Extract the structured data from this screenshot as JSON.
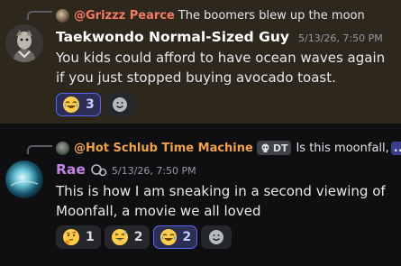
{
  "message1": {
    "reply": {
      "mention": "@Grizzz Pearce",
      "text": "The boomers blew up the moon"
    },
    "author": "Taekwondo Normal-Sized Guy",
    "timestamp": "5/13/26, 7:50 PM",
    "body": "You kids could afford to have ocean waves again if you just stopped buying avocado toast.",
    "reactions": [
      {
        "emoji": "joy-emoji",
        "count": "3",
        "active": true
      }
    ],
    "colors": {
      "mention": "#f47b67",
      "author": "#ffffff",
      "highlight_bg": "#2e271c"
    }
  },
  "message2": {
    "reply": {
      "mention": "@Hot Schlub Time Machine",
      "badge": "DT",
      "text": "Is this moonfall,",
      "overflow": "..."
    },
    "author": "Rae",
    "timestamp": "5/13/26, 7:50 PM",
    "body": "This is how I am sneaking in a second viewing of Moonfall, a movie we all loved",
    "reactions": [
      {
        "emoji": "thinking-emoji",
        "count": "1",
        "active": false
      },
      {
        "emoji": "grin-sweat-emoji",
        "count": "2",
        "active": false
      },
      {
        "emoji": "joy-emoji",
        "count": "2",
        "active": true
      }
    ],
    "colors": {
      "mention": "#f0a24a",
      "author": "#c083e6"
    }
  }
}
